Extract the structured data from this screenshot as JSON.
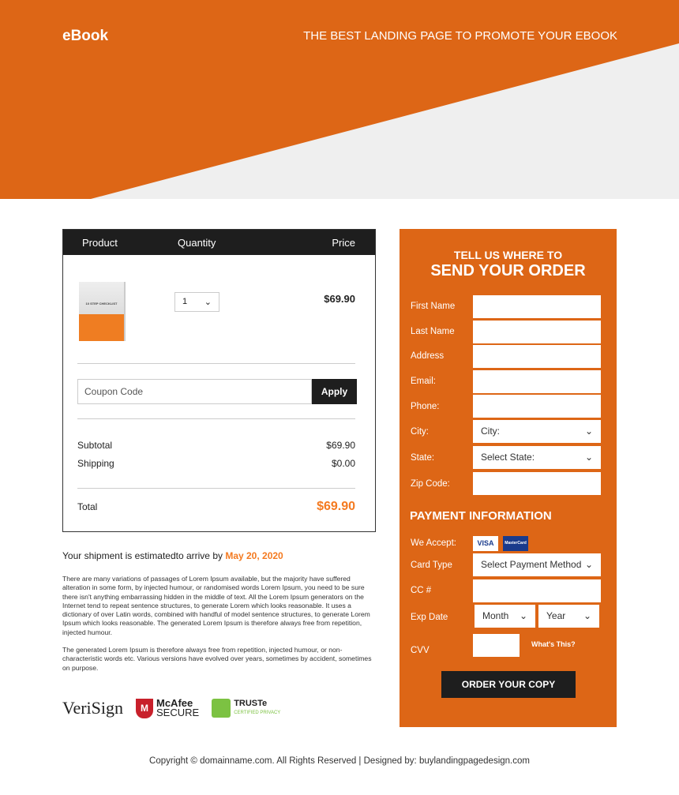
{
  "header": {
    "logo": "eBook",
    "tagline": "THE BEST LANDING PAGE TO PROMOTE YOUR EBOOK"
  },
  "cart": {
    "columns": [
      "Product",
      "Quantity",
      "Price"
    ],
    "product_image_text": "10 STEP CHECKLIST",
    "quantity": "1",
    "price": "$69.90",
    "coupon_placeholder": "Coupon Code",
    "apply_label": "Apply",
    "subtotal_label": "Subtotal",
    "subtotal": "$69.90",
    "shipping_label": "Shipping",
    "shipping": "$0.00",
    "total_label": "Total",
    "total": "$69.90"
  },
  "shipment": {
    "text": "Your shipment is estimatedto arrive by ",
    "date": "May 20, 2020"
  },
  "paragraphs": [
    "There are many variations of passages of Lorem Ipsum available, but the majority have suffered alteration in some form, by injected humour, or randomised words Lorem Ipsum, you need to be sure there isn't anything embarrassing hidden in the middle of text. All the Lorem Ipsum generators on the Internet tend to repeat sentence structures, to generate Lorem which looks reasonable. It uses a dictionary of over Latin words, combined with handful of model sentence structures, to generate Lorem Ipsum which looks reasonable. The generated Lorem Ipsum is therefore always free from repetition, injected humour.",
    "The generated Lorem Ipsum is therefore always free from repetition, injected humour, or non-characteristic words etc. Various versions have evolved over years, sometimes by accident, sometimes on purpose."
  ],
  "badges": {
    "verisign": "VeriSign",
    "mcafee": "McAfee",
    "mcafee_sub": "SECURE",
    "truste": "TRUSTe",
    "truste_sub": "CERTIFIED PRIVACY"
  },
  "form": {
    "title1": "TELL US WHERE TO",
    "title2": "SEND YOUR ORDER",
    "fields": [
      "First Name",
      "Last Name",
      "Address",
      "Email:",
      "Phone:",
      "City:",
      "State:",
      "Zip Code:"
    ],
    "city_value": "City:",
    "state_value": "Select State:",
    "payment_title": "PAYMENT INFORMATION",
    "we_accept": "We Accept:",
    "visa": "VISA",
    "mastercard": "MasterCard",
    "card_type_label": "Card Type",
    "card_type_value": "Select Payment Method",
    "cc_label": "CC #",
    "exp_label": "Exp Date",
    "month": "Month",
    "year": "Year",
    "cvv_label": "CVV",
    "whats_this": "What's This?",
    "order_button": "ORDER YOUR COPY"
  },
  "footer": "Copyright © domainname.com. All Rights Reserved | Designed by: buylandingpagedesign.com",
  "colors": {
    "brand": "#dd6616",
    "accent": "#f47a20",
    "dark": "#1e1e1e"
  }
}
